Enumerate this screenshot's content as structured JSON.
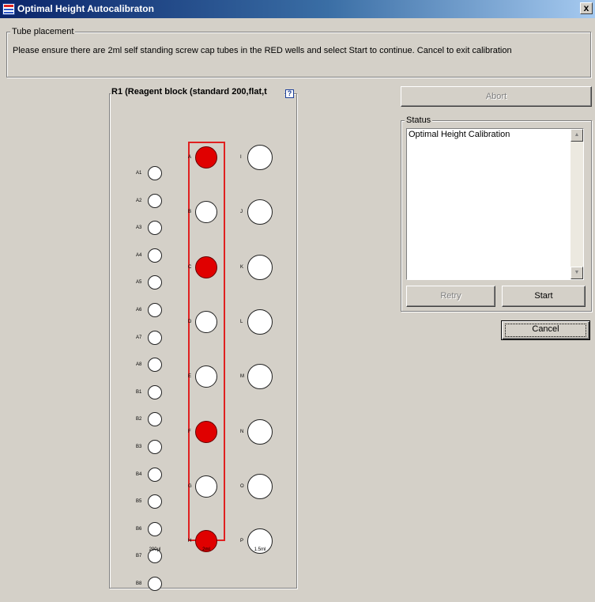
{
  "window": {
    "title": "Optimal Height Autocalibraton",
    "close_label": "x"
  },
  "tube_placement": {
    "legend": "Tube placement",
    "message": "Please ensure there are 2ml self standing screw cap tubes in the RED wells and select Start to continue. Cancel to exit calibration"
  },
  "block": {
    "title": "R1 (Reagent block (standard 200,flat,t",
    "help_label": "?"
  },
  "columns": [
    {
      "name": "200µl",
      "wells": [
        {
          "label": "A1",
          "red": false
        },
        {
          "label": "A2",
          "red": false
        },
        {
          "label": "A3",
          "red": false
        },
        {
          "label": "A4",
          "red": false
        },
        {
          "label": "A5",
          "red": false
        },
        {
          "label": "A6",
          "red": false
        },
        {
          "label": "A7",
          "red": false
        },
        {
          "label": "A8",
          "red": false
        },
        {
          "label": "B1",
          "red": false
        },
        {
          "label": "B2",
          "red": false
        },
        {
          "label": "B3",
          "red": false
        },
        {
          "label": "B4",
          "red": false
        },
        {
          "label": "B5",
          "red": false
        },
        {
          "label": "B6",
          "red": false
        },
        {
          "label": "B7",
          "red": false
        },
        {
          "label": "B8",
          "red": false
        }
      ]
    },
    {
      "name": "2ml",
      "wells": [
        {
          "label": "A",
          "red": true
        },
        {
          "label": "B",
          "red": false
        },
        {
          "label": "C",
          "red": true
        },
        {
          "label": "D",
          "red": false
        },
        {
          "label": "E",
          "red": false
        },
        {
          "label": "F",
          "red": true
        },
        {
          "label": "G",
          "red": false
        },
        {
          "label": "H",
          "red": true
        }
      ]
    },
    {
      "name": "1.5ml",
      "wells": [
        {
          "label": "I",
          "red": false
        },
        {
          "label": "J",
          "red": false
        },
        {
          "label": "K",
          "red": false
        },
        {
          "label": "L",
          "red": false
        },
        {
          "label": "M",
          "red": false
        },
        {
          "label": "N",
          "red": false
        },
        {
          "label": "O",
          "red": false
        },
        {
          "label": "P",
          "red": false
        }
      ]
    }
  ],
  "colors": {
    "red_well": "#e00000",
    "highlight_box": "#e02020"
  },
  "controls": {
    "abort_label": "Abort",
    "status_legend": "Status",
    "status_text": "Optimal Height Calibration",
    "retry_label": "Retry",
    "start_label": "Start",
    "cancel_label": "Cancel"
  }
}
